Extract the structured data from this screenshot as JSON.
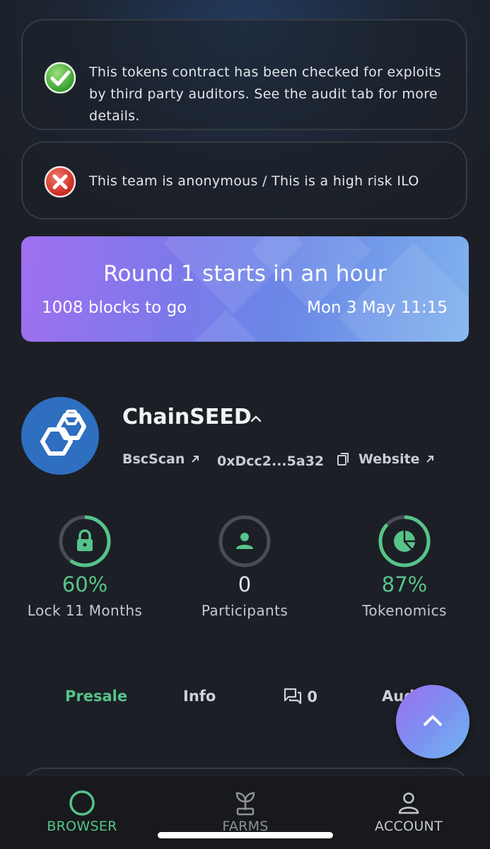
{
  "notices": {
    "audit": {
      "text": "This tokens contract has been checked for exploits by third party auditors. See the audit tab for more details.",
      "status": "pass",
      "icon": "check-circle-icon"
    },
    "anonymous": {
      "text": "This team is anonymous / This is a high risk ILO",
      "status": "fail",
      "icon": "x-circle-icon"
    }
  },
  "round_banner": {
    "title": "Round 1 starts in an hour",
    "blocks": "1008 blocks to go",
    "date": "Mon 3 May 11:15"
  },
  "token": {
    "name": "ChainSEED",
    "logo_icon": "hexagon-chain-logo",
    "links": {
      "bscscan": "BscScan",
      "address": "0xDcc2...5a32",
      "website": "Website"
    }
  },
  "stats": [
    {
      "value": "60%",
      "label": "Lock 11 Months",
      "icon": "lock-icon",
      "progress": 0.6
    },
    {
      "value": "0",
      "label": "Participants",
      "icon": "person-icon",
      "progress": 0
    },
    {
      "value": "87%",
      "label": "Tokenomics",
      "icon": "pie-chart-icon",
      "progress": 0.87
    }
  ],
  "tabs": {
    "presale": "Presale",
    "info": "Info",
    "comments_count": "0",
    "audit": "Audit"
  },
  "bottom_nav": {
    "browser": "BROWSER",
    "farms": "FARMS",
    "account": "ACCOUNT"
  },
  "colors": {
    "accent_green": "#56c48a",
    "ring_track": "#4a4d55",
    "banner_gradient_start": "#a06ff0",
    "banner_gradient_end": "#80b2ee"
  }
}
